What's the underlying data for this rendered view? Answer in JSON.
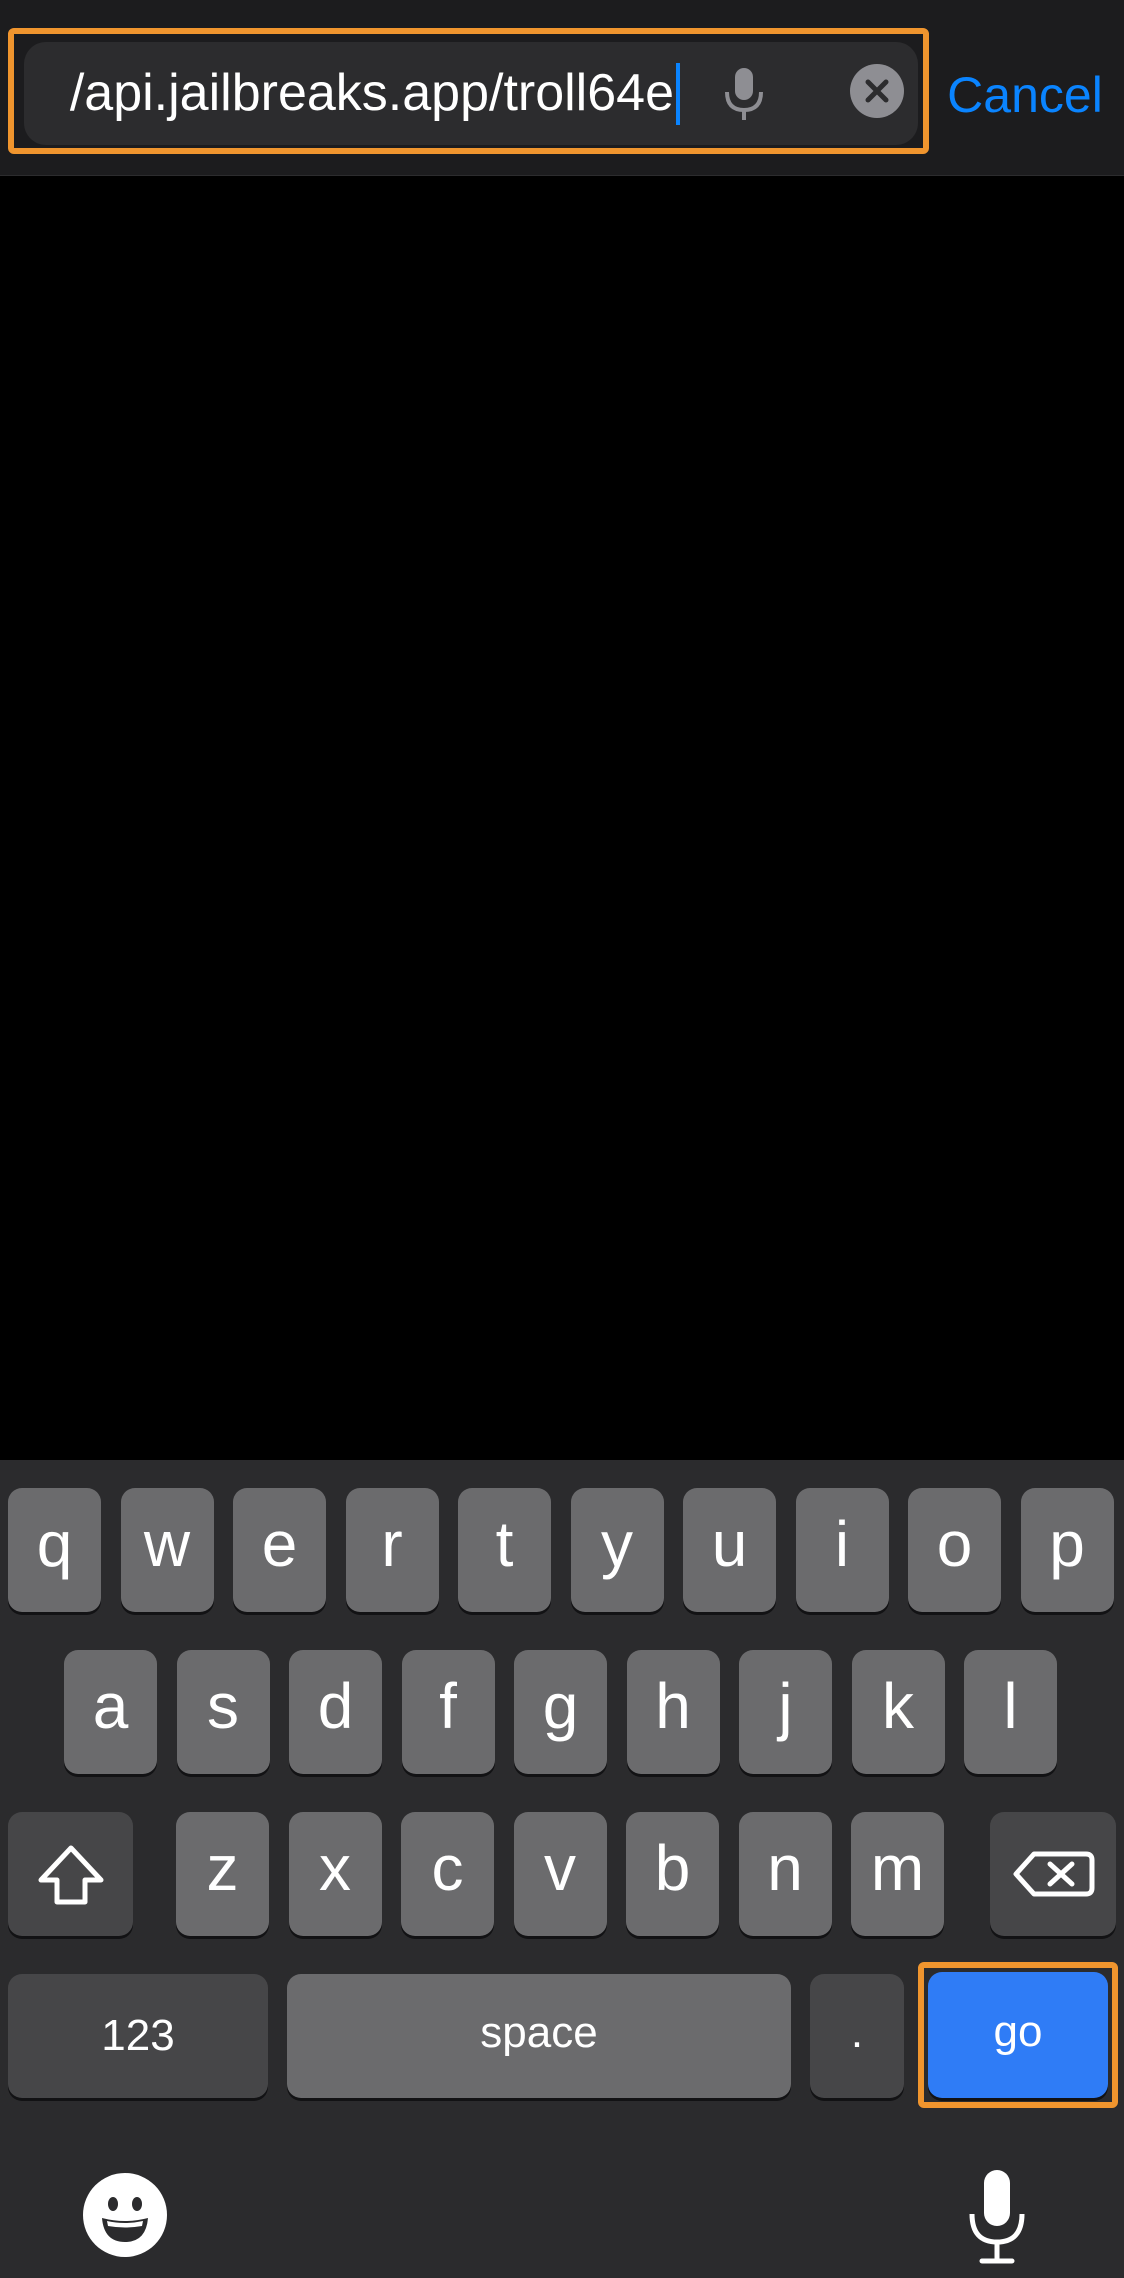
{
  "search": {
    "url_value": "/api.jailbreaks.app/troll64e",
    "cancel_label": "Cancel"
  },
  "icons": {
    "dictation": "microphone-icon",
    "clear": "clear-x-circle-icon",
    "shift": "shift-arrow-icon",
    "delete": "backspace-icon",
    "emoji": "emoji-smiley-icon",
    "bottom_dictation": "microphone-icon"
  },
  "keyboard": {
    "row1": [
      "q",
      "w",
      "e",
      "r",
      "t",
      "y",
      "u",
      "i",
      "o",
      "p"
    ],
    "row2": [
      "a",
      "s",
      "d",
      "f",
      "g",
      "h",
      "j",
      "k",
      "l"
    ],
    "row3": [
      "z",
      "x",
      "c",
      "v",
      "b",
      "n",
      "m"
    ],
    "numbers_label": "123",
    "space_label": "space",
    "period_label": ".",
    "go_label": "go"
  },
  "colors": {
    "accent": "#0a84ff",
    "highlight": "#f0952e",
    "go_key": "#2f7cf6"
  }
}
